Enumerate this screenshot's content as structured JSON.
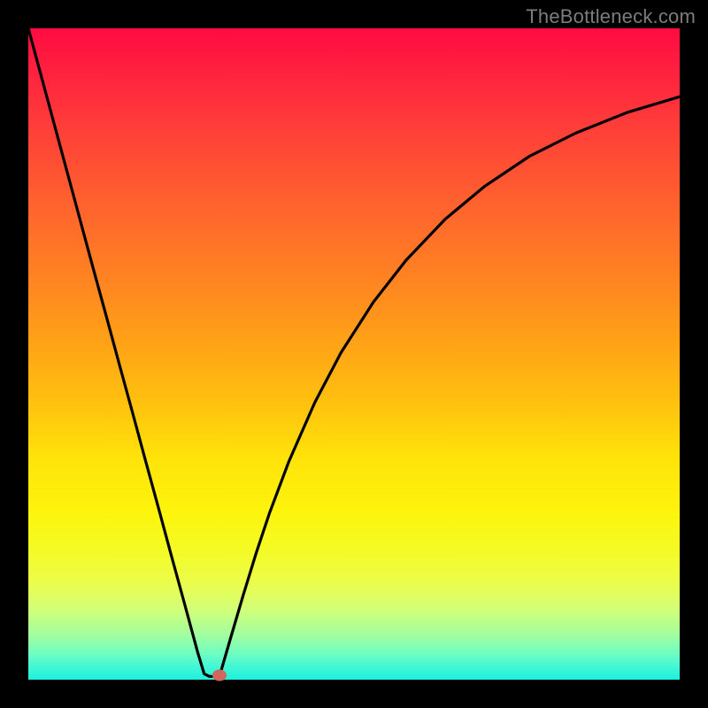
{
  "watermark": "TheBottleneck.com",
  "colors": {
    "background": "#000000",
    "curve": "#000000",
    "marker": "#cf675c"
  },
  "chart_data": {
    "type": "line",
    "title": "",
    "xlabel": "",
    "ylabel": "",
    "xlim": [
      0,
      100
    ],
    "ylim": [
      0,
      100
    ],
    "series": [
      {
        "name": "curve",
        "x": [
          0,
          2,
          4,
          6,
          8,
          10,
          12,
          14,
          16,
          18,
          20,
          22,
          24,
          26,
          27,
          27.8,
          28.6,
          29.4,
          31,
          33,
          35,
          37,
          40,
          44,
          48,
          53,
          58,
          64,
          70,
          77,
          84,
          92,
          100
        ],
        "y": [
          100,
          92.6,
          85.2,
          77.8,
          70.4,
          63.0,
          55.7,
          48.3,
          41.0,
          33.6,
          26.3,
          18.9,
          11.6,
          4.2,
          0.9,
          0.5,
          0.5,
          0.7,
          6.2,
          13.0,
          19.5,
          25.5,
          33.5,
          42.6,
          50.2,
          58.0,
          64.4,
          70.7,
          75.7,
          80.4,
          83.9,
          87.1,
          89.5
        ]
      }
    ],
    "annotations": [
      {
        "name": "min-marker",
        "x": 29.4,
        "y": 0.7
      }
    ],
    "grid": false
  }
}
